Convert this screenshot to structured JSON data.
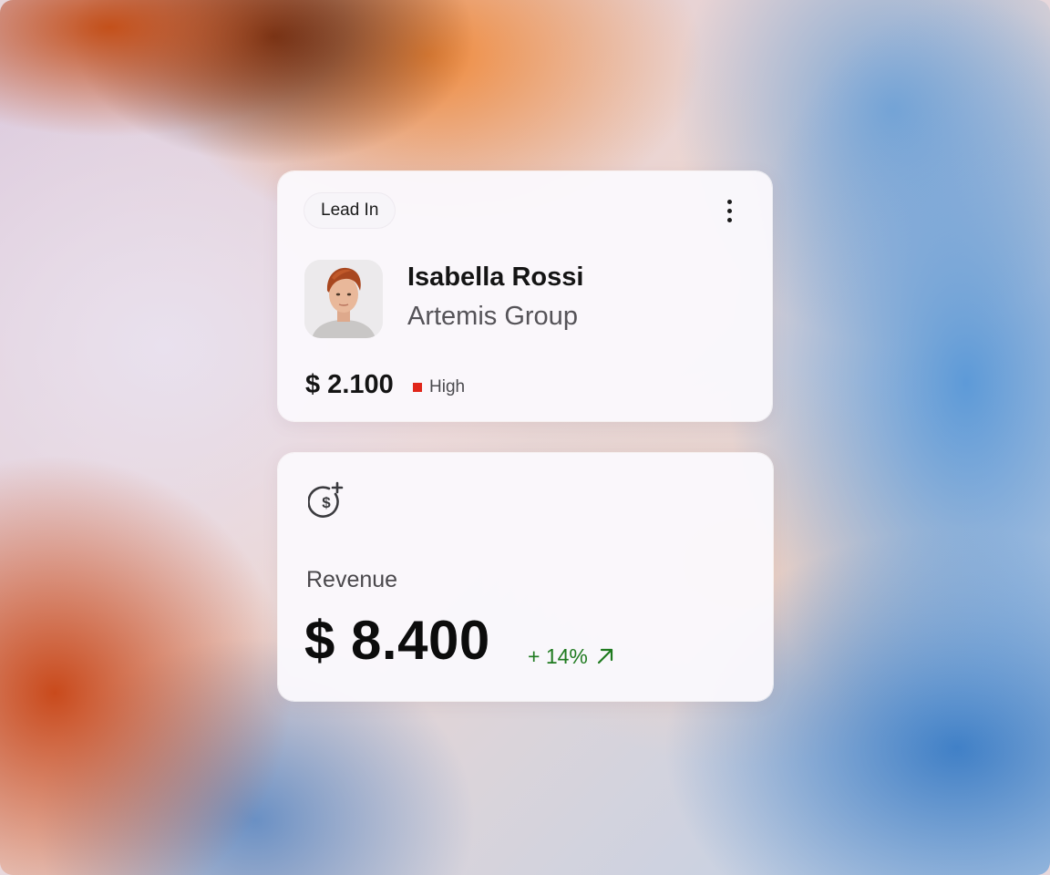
{
  "lead_card": {
    "stage": "Lead In",
    "contact_name": "Isabella Rossi",
    "company": "Artemis Group",
    "amount": "$ 2.100",
    "priority": "High",
    "menu_icon": "more-vertical-icon",
    "avatar_icon": "contact-photo"
  },
  "revenue_card": {
    "icon": "dollar-plus-icon",
    "label": "Revenue",
    "amount": "$ 8.400",
    "change": "+ 14%",
    "change_icon": "arrow-up-right-icon"
  },
  "colors": {
    "priority_high": "#e0261a",
    "positive_change": "#1f7a1f",
    "card_background": "#faf8fc"
  }
}
